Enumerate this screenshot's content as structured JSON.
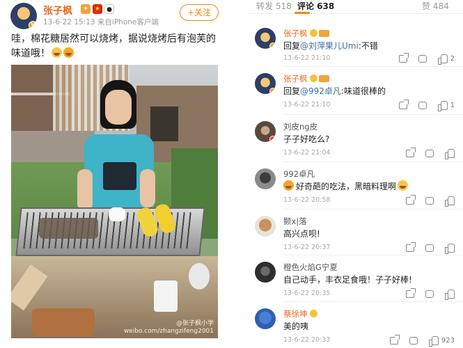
{
  "post": {
    "author": "张子枫",
    "meta": "13-6-22 15:13  来自iPhone客户端",
    "follow_label": "+关注",
    "text": "哇，棉花糖居然可以烧烤，据说烧烤后有泡芙的味道哦！",
    "watermark_line1": "@张子枫小学",
    "watermark_line2": "weibo.com/zhangzifeng2001",
    "icons": [
      "vip-icon",
      "flag-icon",
      "panda-icon"
    ]
  },
  "tabs": [
    {
      "label": "转发 518"
    },
    {
      "label": "评论 638"
    },
    {
      "label": "赞 484"
    }
  ],
  "comments": [
    {
      "name": "张子枫",
      "prefix": "回复",
      "mention": "@刘萍果儿Umi",
      "text": ":不错",
      "time": "13-6-22 21:10",
      "likes": "2"
    },
    {
      "name": "张子枫",
      "prefix": "回复",
      "mention": "@992卓凡",
      "text": ":味道很棒的",
      "time": "13-6-22 21:10",
      "likes": "1"
    },
    {
      "name": "刘皮ng皮",
      "prefix": "",
      "mention": "",
      "text": "子子好吃么?",
      "time": "13-6-22 21:04",
      "likes": ""
    },
    {
      "name": "992卓凡",
      "prefix": "",
      "mention": "",
      "text": "好奇葩的吃法，黑暗料理啊",
      "time": "13-6-22 20:58",
      "likes": ""
    },
    {
      "name": "颢x|落",
      "prefix": "",
      "mention": "",
      "text": "高兴点呗!",
      "time": "13-6-22 20:37",
      "likes": ""
    },
    {
      "name": "橙色火焰G宁夏",
      "prefix": "",
      "mention": "",
      "text": "自己动手，丰衣足食哦！子子好棒!",
      "time": "13-6-22 20:35",
      "likes": ""
    },
    {
      "name": "蔡徐坤",
      "prefix": "",
      "mention": "",
      "text": "美的咦",
      "time": "13-6-22 20:33",
      "likes": "923"
    }
  ]
}
